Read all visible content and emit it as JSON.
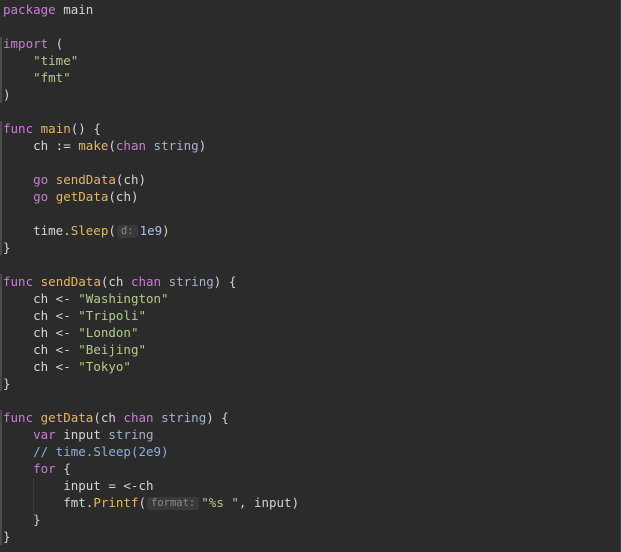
{
  "editor": {
    "lines": [
      [
        {
          "c": "kw",
          "t": "package"
        },
        {
          "c": "op",
          "t": " main"
        }
      ],
      [],
      [
        {
          "c": "kw",
          "t": "import"
        },
        {
          "c": "op",
          "t": " ("
        }
      ],
      [
        {
          "c": "op",
          "t": "    "
        },
        {
          "c": "str",
          "t": "\"time\""
        }
      ],
      [
        {
          "c": "op",
          "t": "    "
        },
        {
          "c": "str",
          "t": "\"fmt\""
        }
      ],
      [
        {
          "c": "op",
          "t": ")"
        }
      ],
      [],
      [
        {
          "c": "kw",
          "t": "func"
        },
        {
          "c": "op",
          "t": " "
        },
        {
          "c": "fn",
          "t": "main"
        },
        {
          "c": "op",
          "t": "() {"
        }
      ],
      [
        {
          "c": "op",
          "t": "    ch := "
        },
        {
          "c": "fn",
          "t": "make"
        },
        {
          "c": "op",
          "t": "("
        },
        {
          "c": "kw",
          "t": "chan"
        },
        {
          "c": "op",
          "t": " "
        },
        {
          "c": "ty",
          "t": "string"
        },
        {
          "c": "op",
          "t": ")"
        }
      ],
      [],
      [
        {
          "c": "op",
          "t": "    "
        },
        {
          "c": "kw",
          "t": "go"
        },
        {
          "c": "op",
          "t": " "
        },
        {
          "c": "fn",
          "t": "sendData"
        },
        {
          "c": "op",
          "t": "(ch)"
        }
      ],
      [
        {
          "c": "op",
          "t": "    "
        },
        {
          "c": "kw",
          "t": "go"
        },
        {
          "c": "op",
          "t": " "
        },
        {
          "c": "fn",
          "t": "getData"
        },
        {
          "c": "op",
          "t": "(ch)"
        }
      ],
      [],
      [
        {
          "c": "op",
          "t": "    time."
        },
        {
          "c": "fn",
          "t": "Sleep"
        },
        {
          "c": "op",
          "t": "("
        },
        {
          "c": "hint",
          "t": "d:"
        },
        {
          "c": "num",
          "t": "1e9"
        },
        {
          "c": "op",
          "t": ")"
        }
      ],
      [
        {
          "c": "op",
          "t": "}"
        }
      ],
      [],
      [
        {
          "c": "kw",
          "t": "func"
        },
        {
          "c": "op",
          "t": " "
        },
        {
          "c": "fn",
          "t": "sendData"
        },
        {
          "c": "op",
          "t": "(ch "
        },
        {
          "c": "kw",
          "t": "chan"
        },
        {
          "c": "op",
          "t": " "
        },
        {
          "c": "ty",
          "t": "string"
        },
        {
          "c": "op",
          "t": ") {"
        }
      ],
      [
        {
          "c": "op",
          "t": "    ch <- "
        },
        {
          "c": "str",
          "t": "\"Washington\""
        }
      ],
      [
        {
          "c": "op",
          "t": "    ch <- "
        },
        {
          "c": "str",
          "t": "\"Tripoli\""
        }
      ],
      [
        {
          "c": "op",
          "t": "    ch <- "
        },
        {
          "c": "str",
          "t": "\"London\""
        }
      ],
      [
        {
          "c": "op",
          "t": "    ch <- "
        },
        {
          "c": "str",
          "t": "\"Beijing\""
        }
      ],
      [
        {
          "c": "op",
          "t": "    ch <- "
        },
        {
          "c": "str",
          "t": "\"Tokyo\""
        }
      ],
      [
        {
          "c": "op",
          "t": "}"
        }
      ],
      [],
      [
        {
          "c": "kw",
          "t": "func"
        },
        {
          "c": "op",
          "t": " "
        },
        {
          "c": "fn",
          "t": "getData"
        },
        {
          "c": "op",
          "t": "(ch "
        },
        {
          "c": "kw",
          "t": "chan"
        },
        {
          "c": "op",
          "t": " "
        },
        {
          "c": "ty",
          "t": "string"
        },
        {
          "c": "op",
          "t": ") {"
        }
      ],
      [
        {
          "c": "op",
          "t": "    "
        },
        {
          "c": "kw",
          "t": "var"
        },
        {
          "c": "op",
          "t": " input "
        },
        {
          "c": "ty",
          "t": "string"
        }
      ],
      [
        {
          "c": "op",
          "t": "    "
        },
        {
          "c": "cm",
          "t": "// time.Sleep(2e9)"
        }
      ],
      [
        {
          "c": "op",
          "t": "    "
        },
        {
          "c": "kw",
          "t": "for"
        },
        {
          "c": "op",
          "t": " {"
        }
      ],
      [
        {
          "c": "op",
          "t": "        input = <-ch"
        }
      ],
      [
        {
          "c": "op",
          "t": "        fmt."
        },
        {
          "c": "fn",
          "t": "Printf"
        },
        {
          "c": "op",
          "t": "("
        },
        {
          "c": "hint",
          "t": "format:"
        },
        {
          "c": "str",
          "t": "\"%s \""
        },
        {
          "c": "op",
          "t": ", input)"
        }
      ],
      [
        {
          "c": "op",
          "t": "    }"
        }
      ],
      [
        {
          "c": "op",
          "t": "}"
        }
      ]
    ]
  }
}
